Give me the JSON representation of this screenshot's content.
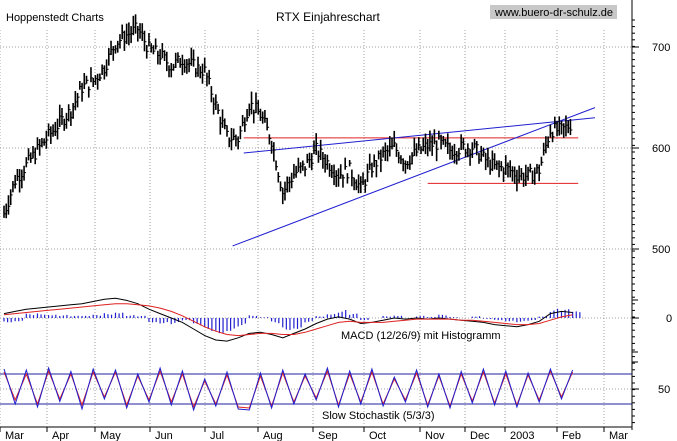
{
  "header": {
    "publisher": "Hoppenstedt Charts",
    "title": "RTX Einjahreschart",
    "website": "www.buero-dr-schulz.de"
  },
  "colors": {
    "price": "#000000",
    "trendline": "#1f1fd0",
    "support_resistance": "#e02020",
    "grid": "#a0a0a0",
    "histogram": "#2020d0",
    "macd_line": "#000000",
    "signal_line": "#e02020",
    "stoch_k": "#2020d0",
    "stoch_d": "#e02020",
    "stoch_band": "#2020a0",
    "website_bg": "#c8c8c8"
  },
  "chart_data": [
    {
      "type": "line",
      "panel": "price",
      "title": "RTX Einjahreschart",
      "ylim": [
        465,
        735
      ],
      "yticks": [
        500,
        600,
        700
      ],
      "x_months": [
        "Mar",
        "Apr",
        "May",
        "Jun",
        "Jul",
        "Aug",
        "Sep",
        "Oct",
        "Nov",
        "Dec",
        "2003",
        "Feb",
        "Mar"
      ],
      "series": [
        {
          "style": "ohlc-bars",
          "x_week": [
            0,
            1,
            2,
            3,
            4,
            5,
            6,
            7,
            8,
            9,
            10,
            11,
            12,
            13,
            14,
            15,
            16,
            17,
            18,
            19,
            20,
            21,
            22,
            23,
            24,
            25,
            26,
            27,
            28,
            29,
            30,
            31,
            32,
            33,
            34,
            35,
            36,
            37,
            38,
            39,
            40,
            41,
            42,
            43,
            44,
            45,
            46,
            47,
            48,
            49,
            50,
            51
          ],
          "close": [
            535,
            568,
            583,
            598,
            612,
            625,
            637,
            660,
            666,
            680,
            704,
            712,
            718,
            698,
            692,
            681,
            688,
            681,
            676,
            642,
            611,
            609,
            644,
            633,
            608,
            556,
            574,
            582,
            598,
            586,
            574,
            578,
            560,
            581,
            593,
            601,
            586,
            596,
            602,
            605,
            598,
            600,
            601,
            590,
            581,
            580,
            574,
            572,
            578,
            618,
            617,
            625
          ]
        }
      ],
      "lines": [
        {
          "kind": "resistance",
          "color": "red",
          "x_week": [
            21.5,
            51.5
          ],
          "y": [
            610,
            610
          ]
        },
        {
          "kind": "support",
          "color": "red",
          "x_week": [
            38.0,
            51.5
          ],
          "y": [
            565,
            565
          ]
        },
        {
          "kind": "trend-upper",
          "color": "blue",
          "x_week": [
            21.5,
            53
          ],
          "y": [
            595,
            630
          ]
        },
        {
          "kind": "trend-lower",
          "color": "blue",
          "x_week": [
            20.5,
            53
          ],
          "y": [
            503,
            640
          ]
        }
      ]
    },
    {
      "type": "bar",
      "panel": "macd",
      "label": "MACD (12/26/9) mit Histogramm",
      "yticks": [
        0
      ],
      "ylim": [
        -30,
        30
      ],
      "x_week": [
        0,
        1,
        2,
        3,
        4,
        5,
        6,
        7,
        8,
        9,
        10,
        11,
        12,
        13,
        14,
        15,
        16,
        17,
        18,
        19,
        20,
        21,
        22,
        23,
        24,
        25,
        26,
        27,
        28,
        29,
        30,
        31,
        32,
        33,
        34,
        35,
        36,
        37,
        38,
        39,
        40,
        41,
        42,
        43,
        44,
        45,
        46,
        47,
        48,
        49,
        50,
        51
      ],
      "histogram": [
        -4,
        -3,
        4,
        5,
        4,
        3,
        2,
        2,
        3,
        5,
        7,
        3,
        2,
        -4,
        -5,
        -6,
        -3,
        -8,
        -12,
        -14,
        -12,
        -8,
        3,
        1,
        -5,
        -11,
        -10,
        -4,
        2,
        5,
        8,
        4,
        -2,
        0,
        2,
        3,
        0,
        2,
        1,
        3,
        1,
        0,
        2,
        -1,
        -2,
        -3,
        -4,
        -3,
        2,
        9,
        8,
        6
      ],
      "macd_line": [
        4,
        6,
        8,
        9,
        10,
        11,
        12,
        13,
        15,
        17,
        18,
        16,
        13,
        8,
        4,
        0,
        -4,
        -10,
        -16,
        -20,
        -21,
        -18,
        -14,
        -13,
        -15,
        -18,
        -14,
        -10,
        -5,
        -1,
        1,
        -1,
        -5,
        -4,
        -2,
        0,
        -1,
        0,
        -1,
        0,
        -1,
        -2,
        -3,
        -4,
        -6,
        -7,
        -8,
        -6,
        -3,
        4,
        6,
        5
      ],
      "signal_line": [
        3,
        4,
        5,
        6,
        7,
        8,
        9,
        10,
        11,
        12,
        13,
        13,
        12,
        11,
        9,
        6,
        2,
        -3,
        -8,
        -12,
        -15,
        -16,
        -15,
        -14,
        -14,
        -15,
        -15,
        -13,
        -10,
        -7,
        -4,
        -3,
        -4,
        -4,
        -4,
        -3,
        -2,
        -1,
        -1,
        -1,
        -1,
        -2,
        -2,
        -3,
        -4,
        -5,
        -6,
        -6,
        -5,
        -2,
        1,
        3
      ]
    },
    {
      "type": "line",
      "panel": "stochastic",
      "label": "Slow Stochastik (5/3/3)",
      "yticks": [
        50
      ],
      "ylim": [
        0,
        100
      ],
      "bands": [
        20,
        80
      ],
      "x_week": [
        0,
        1,
        2,
        3,
        4,
        5,
        6,
        7,
        8,
        9,
        10,
        11,
        12,
        13,
        14,
        15,
        16,
        17,
        18,
        19,
        20,
        21,
        22,
        23,
        24,
        25,
        26,
        27,
        28,
        29,
        30,
        31,
        32,
        33,
        34,
        35,
        36,
        37,
        38,
        39,
        40,
        41,
        42,
        43,
        44,
        45,
        46,
        47,
        48,
        49,
        50,
        51
      ],
      "stoch_k": [
        90,
        20,
        88,
        14,
        92,
        25,
        85,
        10,
        90,
        30,
        88,
        12,
        80,
        24,
        92,
        18,
        86,
        8,
        70,
        16,
        84,
        10,
        8,
        82,
        12,
        88,
        20,
        80,
        28,
        92,
        14,
        86,
        20,
        90,
        16,
        74,
        24,
        88,
        14,
        80,
        12,
        85,
        22,
        90,
        18,
        86,
        14,
        82,
        24,
        90,
        30,
        88
      ],
      "stoch_d": [
        84,
        28,
        80,
        20,
        86,
        30,
        80,
        18,
        84,
        34,
        84,
        18,
        76,
        28,
        86,
        24,
        80,
        14,
        66,
        20,
        78,
        14,
        12,
        76,
        16,
        82,
        24,
        76,
        32,
        86,
        18,
        80,
        24,
        84,
        20,
        70,
        28,
        82,
        18,
        76,
        16,
        80,
        26,
        84,
        22,
        80,
        18,
        78,
        28,
        86,
        34,
        84
      ]
    }
  ]
}
